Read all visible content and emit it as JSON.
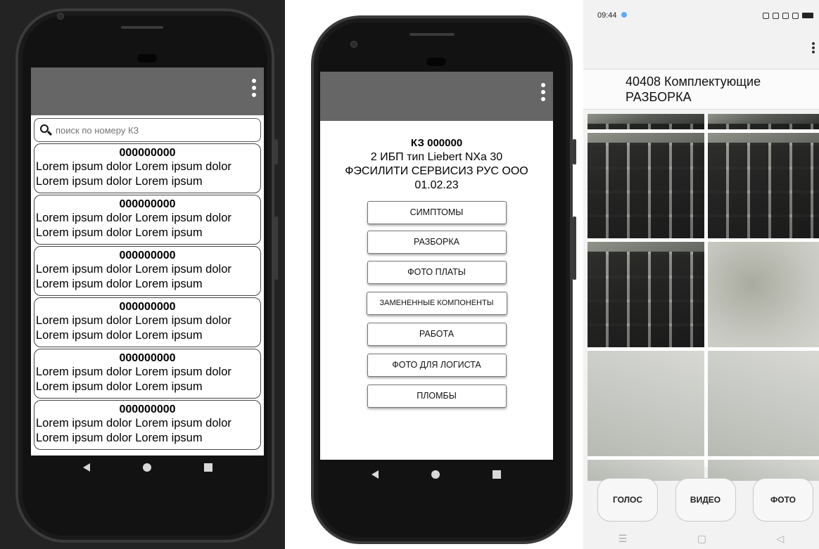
{
  "phone1": {
    "search_placeholder": "поиск по номеру КЗ",
    "items": [
      {
        "number": "000000000",
        "line1": "Lorem ipsum dolor Lorem ipsum dolor",
        "line2": "Lorem ipsum dolor Lorem ipsum"
      },
      {
        "number": "000000000",
        "line1": "Lorem ipsum dolor Lorem ipsum dolor",
        "line2": "Lorem ipsum dolor Lorem ipsum"
      },
      {
        "number": "000000000",
        "line1": "Lorem ipsum dolor Lorem ipsum dolor",
        "line2": "Lorem ipsum dolor Lorem ipsum"
      },
      {
        "number": "000000000",
        "line1": "Lorem ipsum dolor Lorem ipsum dolor",
        "line2": "Lorem ipsum dolor Lorem ipsum"
      },
      {
        "number": "000000000",
        "line1": "Lorem ipsum dolor Lorem ipsum dolor",
        "line2": "Lorem ipsum dolor Lorem ipsum"
      },
      {
        "number": "000000000",
        "line1": "Lorem ipsum dolor Lorem ipsum dolor",
        "line2": "Lorem ipsum dolor Lorem ipsum"
      }
    ]
  },
  "phone2": {
    "ks_number": "КЗ 000000",
    "device_line": "2 ИБП  тип Liebert NXa 30",
    "company": "ФЭСИЛИТИ СЕРВИСИЗ РУС ООО",
    "date": "01.02.23",
    "buttons": {
      "symptoms": "СИМПТОМЫ",
      "disassembly": "РАЗБОРКА",
      "board_photo": "ФОТО ПЛАТЫ",
      "replaced_components": "ЗАМЕНЕННЫЕ КОМПОНЕНТЫ",
      "work": "РАБОТА",
      "logistics_photo": "ФОТО ДЛЯ ЛОГИСТА",
      "seals": "ПЛОМБЫ"
    }
  },
  "phone3": {
    "time": "09:44",
    "title_line1": "40408 Комплектующие",
    "title_line2": "РАЗБОРКА",
    "buttons": {
      "voice": "ГОЛОС",
      "video": "ВИДЕО",
      "photo": "ФОТО"
    }
  },
  "colors": {
    "appbar": "#666666",
    "phone_frame": "#121212",
    "page_bg": "#232323"
  }
}
